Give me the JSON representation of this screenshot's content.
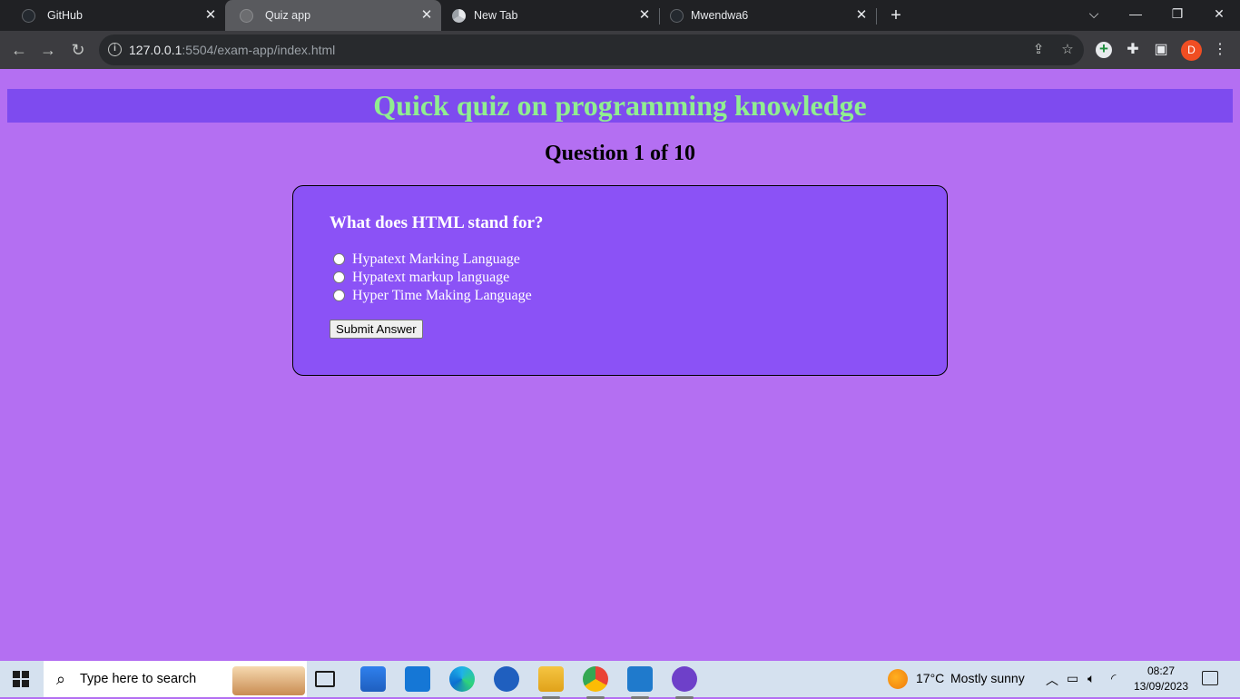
{
  "browser": {
    "tabs": [
      {
        "label": "GitHub",
        "active": false
      },
      {
        "label": "Quiz app",
        "active": true
      },
      {
        "label": "New Tab",
        "active": false
      },
      {
        "label": "Mwendwa6",
        "active": false
      }
    ],
    "url_host": "127.0.0.1",
    "url_rest": ":5504/exam-app/index.html",
    "profile_initial": "D"
  },
  "page": {
    "title": "Quick quiz on programming knowledge",
    "progress": "Question 1 of 10",
    "question": "What does HTML stand for?",
    "options": [
      "Hypatext Marking Language",
      "Hypatext markup language",
      "Hyper Time Making Language"
    ],
    "submit_label": "Submit Answer"
  },
  "taskbar": {
    "search_placeholder": "Type here to search",
    "weather_temp": "17°C",
    "weather_desc": "Mostly sunny",
    "time": "08:27",
    "date": "13/09/2023"
  },
  "colors": {
    "page_bg": "#b46ff2",
    "banner_bg": "#7e4bef",
    "title_text": "#90ee90",
    "card_bg": "#8b52f6"
  }
}
